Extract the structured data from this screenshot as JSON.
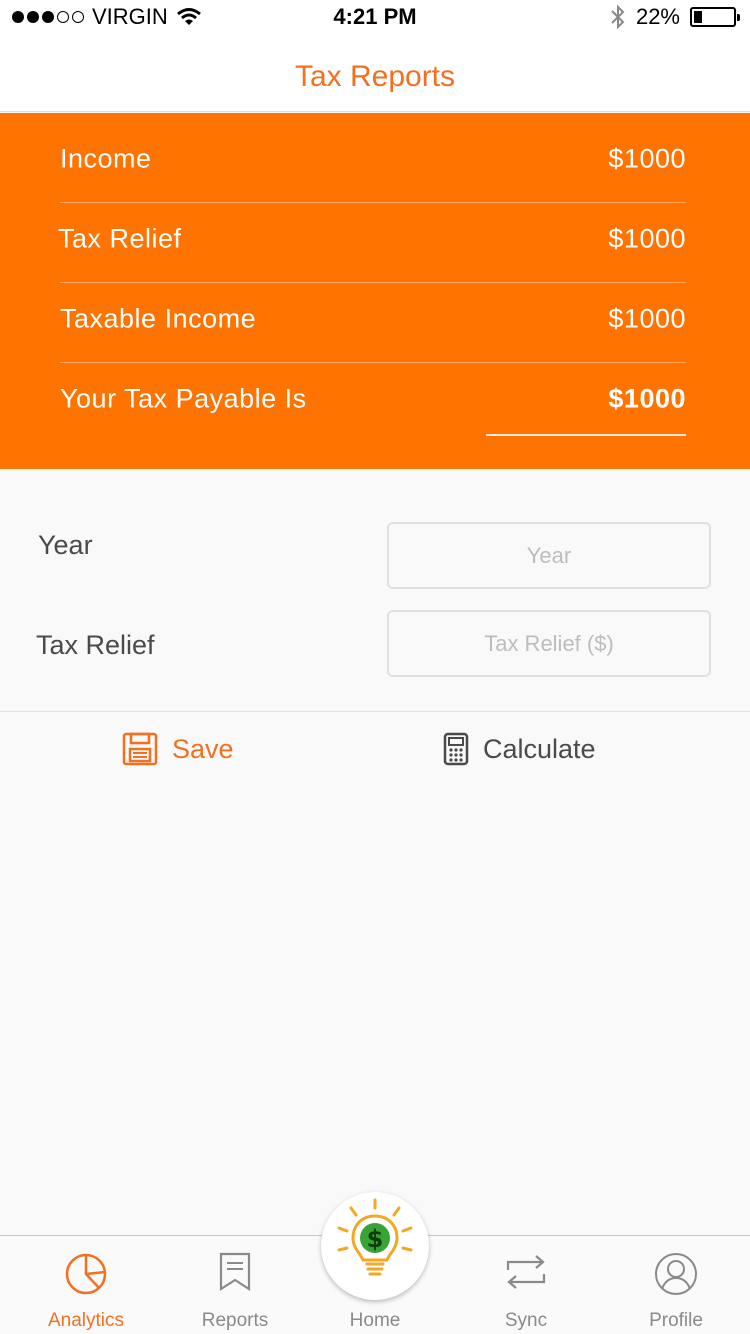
{
  "status_bar": {
    "carrier": "VIRGIN",
    "time": "4:21 PM",
    "battery_percent": "22%",
    "battery_level": 0.22
  },
  "nav": {
    "title": "Tax Reports"
  },
  "summary": {
    "rows": [
      {
        "label": "Income",
        "value": "$1000"
      },
      {
        "label": "Tax Relief",
        "value": "$1000"
      },
      {
        "label": "Taxable Income",
        "value": "$1000"
      },
      {
        "label": "Your Tax Payable Is",
        "value": "$1000"
      }
    ]
  },
  "form": {
    "year_label": "Year",
    "year_placeholder": "Year",
    "relief_label": "Tax Relief",
    "relief_placeholder": "Tax Relief ($)"
  },
  "actions": {
    "save_label": "Save",
    "calculate_label": "Calculate"
  },
  "tabbar": {
    "tabs": [
      {
        "label": "Analytics",
        "icon": "pie-chart-icon"
      },
      {
        "label": "Reports",
        "icon": "bookmark-icon"
      },
      {
        "label": "Home",
        "icon": "lightbulb-dollar-icon"
      },
      {
        "label": "Sync",
        "icon": "sync-arrows-icon"
      },
      {
        "label": "Profile",
        "icon": "profile-icon"
      }
    ]
  },
  "colors": {
    "accent": "#ff7300",
    "title_orange": "#f37021",
    "background": "#f9f9f9"
  }
}
